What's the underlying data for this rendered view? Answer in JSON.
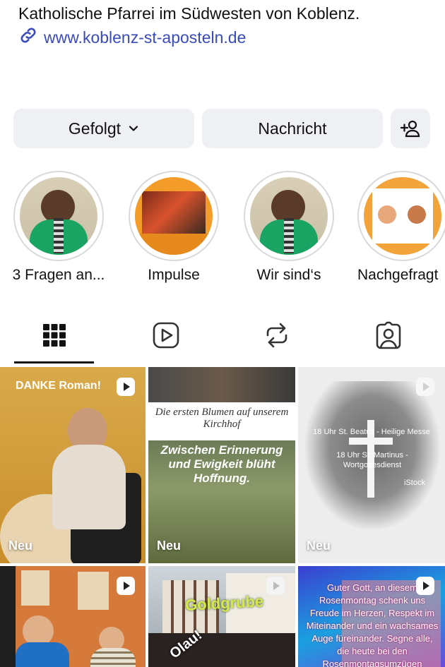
{
  "profile": {
    "bio": "Katholische Pfarrei im Südwesten von Koblenz.",
    "link": "www.koblenz-st-aposteln.de"
  },
  "actions": {
    "follow_label": "Gefolgt",
    "message_label": "Nachricht"
  },
  "highlights": [
    {
      "label": "3 Fragen an..."
    },
    {
      "label": "Impulse"
    },
    {
      "label": "Wir sind‘s"
    },
    {
      "label": "Nachgefragt"
    }
  ],
  "posts": [
    {
      "badge": "Neu",
      "overlay": "DANKE Roman!"
    },
    {
      "badge": "Neu",
      "overlay": "Die ersten Blumen auf unserem Kirchhof",
      "overlay2": "Zwischen Erinnerung und Ewigkeit blüht Hoffnung."
    },
    {
      "badge": "Neu",
      "overlay": "18 Uhr St. Beatus - Heilige Messe",
      "overlay2": "18 Uhr St. Martinus - Wortgottesdienst",
      "credit": "iStock"
    },
    {
      "overlay": ""
    },
    {
      "overlay": "Goldgrube",
      "overlay2": "Olau!"
    },
    {
      "overlay": "Guter Gott, an diesem Rosenmontag schenk uns Freude im Herzen, Respekt im Miteinander und ein wachsames Auge füreinander. Segne alle, die heute bei den Rosenmontagsumzügen unterwegs"
    }
  ],
  "icons": {
    "link": "link-icon",
    "chevron": "chevron-down-icon",
    "add_user": "add-user-icon",
    "grid": "grid-icon",
    "reels": "reels-icon",
    "repost": "repost-icon",
    "tagged": "tagged-icon"
  },
  "colors": {
    "link": "#3a4bbd",
    "button_bg": "#eef0f3"
  }
}
